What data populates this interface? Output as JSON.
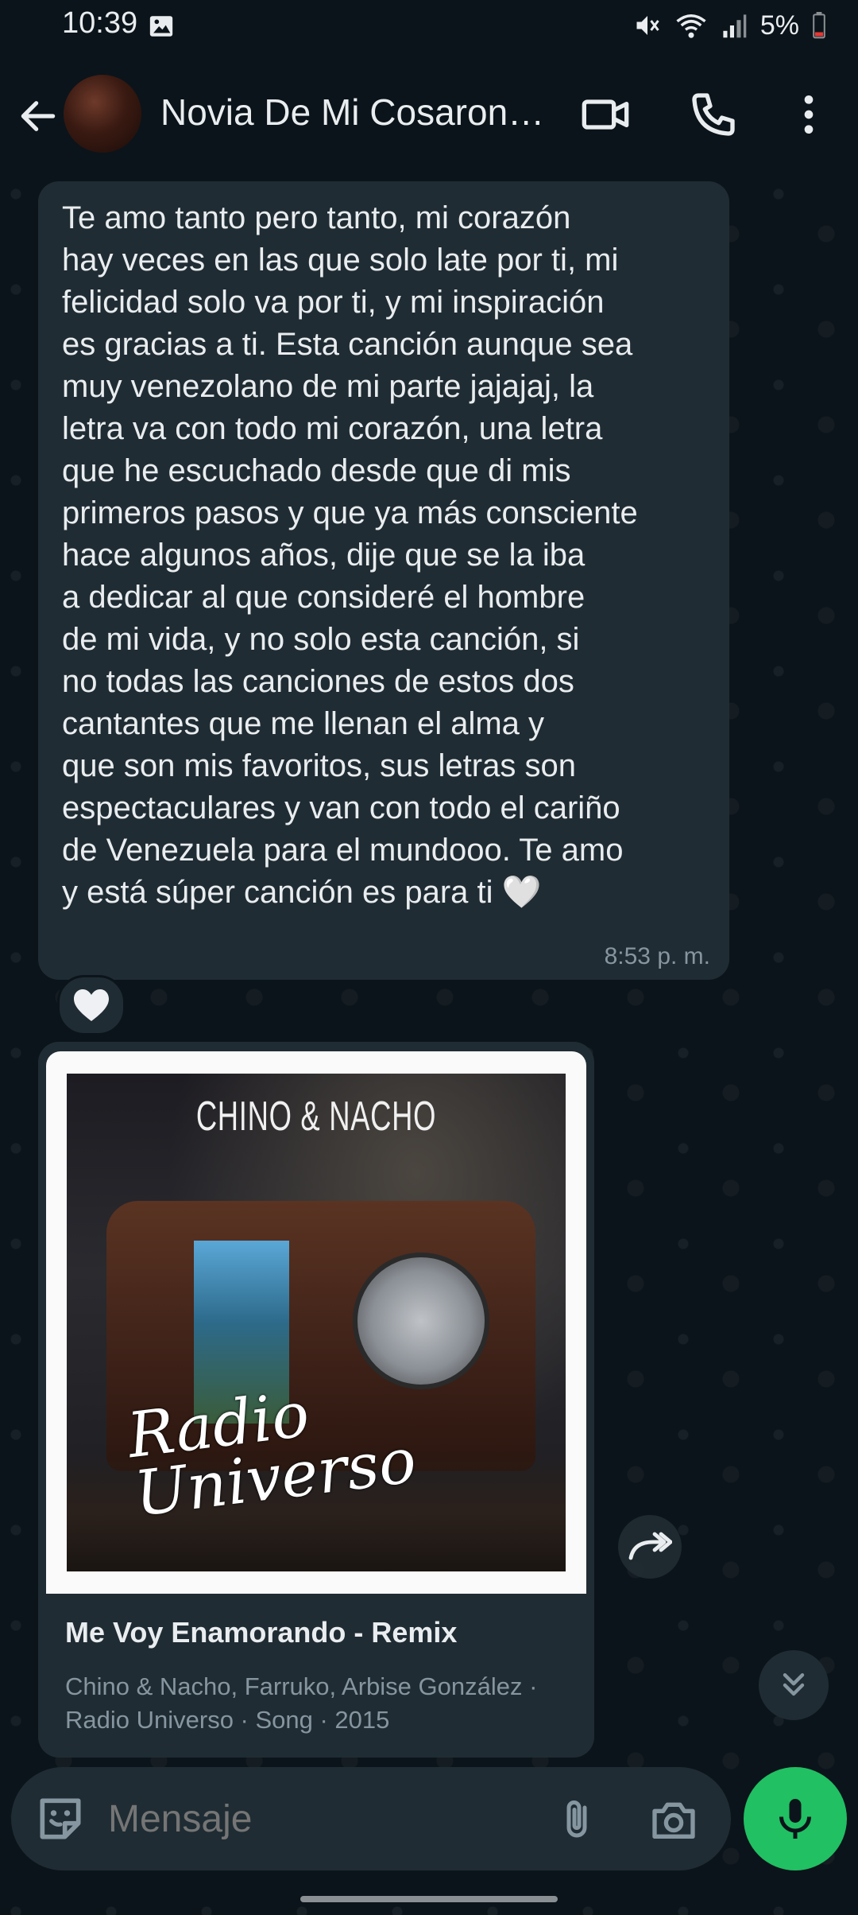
{
  "status_bar": {
    "time": "10:39",
    "battery_percent": "5%"
  },
  "header": {
    "contact_name": "Novia De Mi Cosaron…"
  },
  "message": {
    "text": "Te amo tanto pero tanto, mi corazón\nhay veces en las que solo late por ti, mi\nfelicidad solo va por ti, y mi inspiración\nes gracias a ti. Esta canción aunque sea\nmuy venezolano de mi parte jajajaj, la\nletra va con todo mi corazón, una letra\nque he escuchado desde que di mis\nprimeros pasos y que ya más consciente\nhace algunos años, dije que se la iba\na dedicar al que consideré el hombre\nde mi vida, y no solo esta canción, si\nno todas las canciones de estos dos\ncantantes que me llenan el alma y\nque son mis favoritos, sus letras son\nespectaculares y van con todo el cariño\nde Venezuela para el mundooo. Te amo\ny está súper canción es para ti 🤍",
    "time": "8:53 p. m.",
    "reaction": "🤍"
  },
  "music_card": {
    "cover_artist": "CHINO & NACHO",
    "cover_title": "Radio Universo",
    "song_title": "Me Voy Enamorando - Remix",
    "meta_line1": "Chino & Nacho, Farruko, Arbise González ·",
    "meta_line2": "Radio Universo · Song · 2015"
  },
  "composer": {
    "placeholder": "Mensaje"
  },
  "colors": {
    "background": "#0b141a",
    "bubble_incoming": "#202c33",
    "accent_green": "#21c063",
    "secondary_text": "#8696a0"
  },
  "icons": {
    "back": "arrow-left-icon",
    "video_call": "video-camera-icon",
    "voice_call": "phone-icon",
    "menu": "more-vertical-icon",
    "forward": "forward-icon",
    "scroll_down": "chevrons-down-icon",
    "emoji": "sticker-icon",
    "attach": "paperclip-icon",
    "camera": "camera-icon",
    "mic": "microphone-icon"
  }
}
